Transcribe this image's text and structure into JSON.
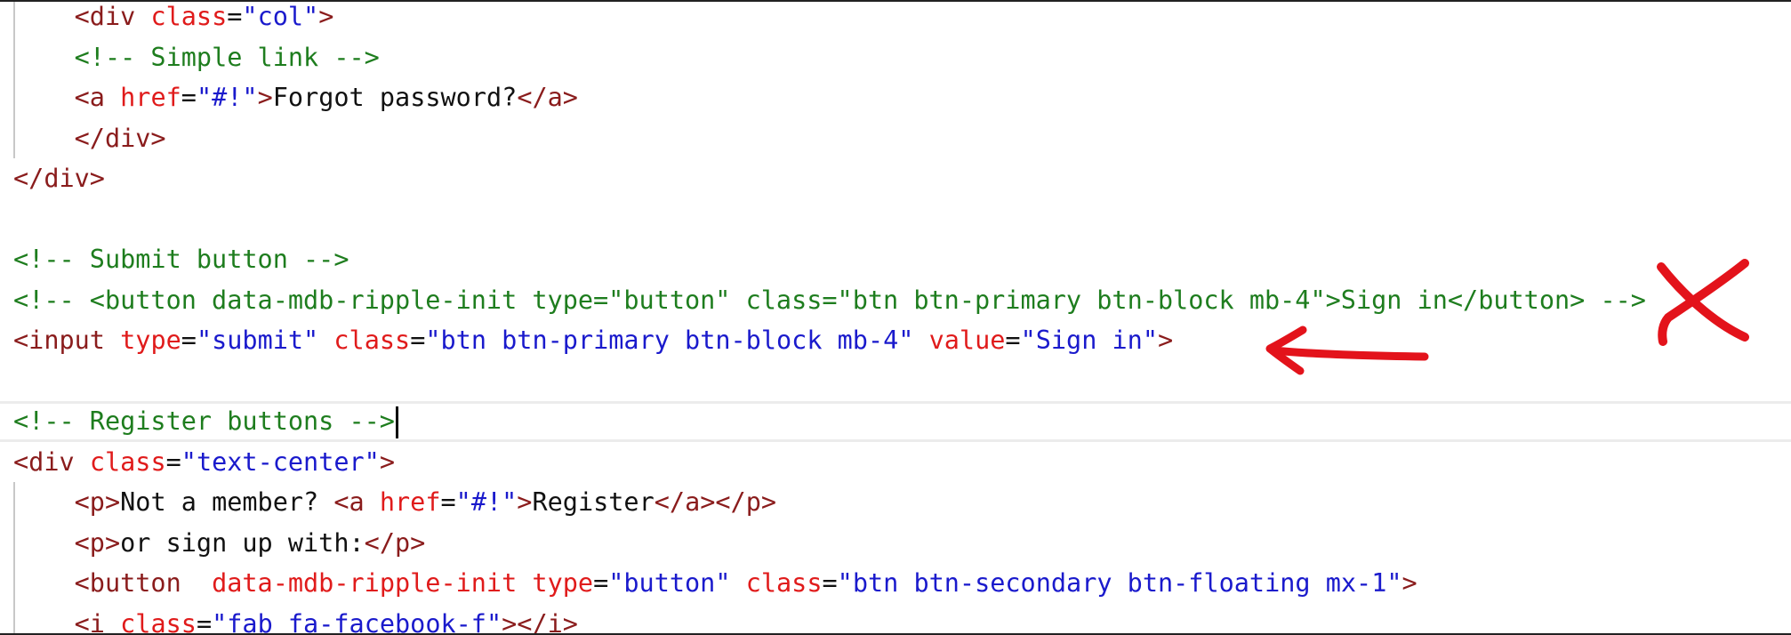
{
  "editor": {
    "lines": [
      {
        "indent": 1,
        "guide": true,
        "tokens": [
          {
            "t": "tag",
            "v": "<div"
          },
          {
            "t": "txt",
            "v": " "
          },
          {
            "t": "attr",
            "v": "class"
          },
          {
            "t": "eq",
            "v": "="
          },
          {
            "t": "str",
            "v": "\"col\""
          },
          {
            "t": "tag",
            "v": ">"
          }
        ]
      },
      {
        "indent": 1,
        "guide": true,
        "tokens": [
          {
            "t": "cmt",
            "v": "<!-- Simple link -->"
          }
        ]
      },
      {
        "indent": 1,
        "guide": true,
        "tokens": [
          {
            "t": "tag",
            "v": "<a"
          },
          {
            "t": "txt",
            "v": " "
          },
          {
            "t": "attr",
            "v": "href"
          },
          {
            "t": "eq",
            "v": "="
          },
          {
            "t": "str",
            "v": "\"#!\""
          },
          {
            "t": "tag",
            "v": ">"
          },
          {
            "t": "txt",
            "v": "Forgot password?"
          },
          {
            "t": "tag",
            "v": "</a>"
          }
        ]
      },
      {
        "indent": 1,
        "guide": true,
        "tokens": [
          {
            "t": "tag",
            "v": "</div>"
          }
        ]
      },
      {
        "indent": 0,
        "guide": false,
        "tokens": [
          {
            "t": "tag",
            "v": "</div>"
          }
        ]
      },
      {
        "indent": 0,
        "guide": false,
        "tokens": []
      },
      {
        "indent": 0,
        "guide": false,
        "tokens": [
          {
            "t": "cmt",
            "v": "<!-- Submit button -->"
          }
        ]
      },
      {
        "indent": 0,
        "guide": false,
        "tokens": [
          {
            "t": "cmt",
            "v": "<!-- <button data-mdb-ripple-init type=\"button\" class=\"btn btn-primary btn-block mb-4\">Sign in</button> -->"
          }
        ]
      },
      {
        "indent": 0,
        "guide": false,
        "tokens": [
          {
            "t": "tag",
            "v": "<input"
          },
          {
            "t": "txt",
            "v": " "
          },
          {
            "t": "attr",
            "v": "type"
          },
          {
            "t": "eq",
            "v": "="
          },
          {
            "t": "str",
            "v": "\"submit\""
          },
          {
            "t": "txt",
            "v": " "
          },
          {
            "t": "attr",
            "v": "class"
          },
          {
            "t": "eq",
            "v": "="
          },
          {
            "t": "str",
            "v": "\"btn btn-primary btn-block mb-4\""
          },
          {
            "t": "txt",
            "v": " "
          },
          {
            "t": "attr",
            "v": "value"
          },
          {
            "t": "eq",
            "v": "="
          },
          {
            "t": "str",
            "v": "\"Sign in\""
          },
          {
            "t": "tag",
            "v": ">"
          }
        ]
      },
      {
        "indent": 0,
        "guide": false,
        "tokens": []
      },
      {
        "indent": 0,
        "guide": false,
        "current": true,
        "caret": true,
        "tokens": [
          {
            "t": "cmt",
            "v": "<!-- Register buttons -->"
          }
        ]
      },
      {
        "indent": 0,
        "guide": false,
        "tokens": [
          {
            "t": "tag",
            "v": "<div"
          },
          {
            "t": "txt",
            "v": " "
          },
          {
            "t": "attr",
            "v": "class"
          },
          {
            "t": "eq",
            "v": "="
          },
          {
            "t": "str",
            "v": "\"text-center\""
          },
          {
            "t": "tag",
            "v": ">"
          }
        ]
      },
      {
        "indent": 1,
        "guide": true,
        "tokens": [
          {
            "t": "tag",
            "v": "<p>"
          },
          {
            "t": "txt",
            "v": "Not a member? "
          },
          {
            "t": "tag",
            "v": "<a"
          },
          {
            "t": "txt",
            "v": " "
          },
          {
            "t": "attr",
            "v": "href"
          },
          {
            "t": "eq",
            "v": "="
          },
          {
            "t": "str",
            "v": "\"#!\""
          },
          {
            "t": "tag",
            "v": ">"
          },
          {
            "t": "txt",
            "v": "Register"
          },
          {
            "t": "tag",
            "v": "</a></p>"
          }
        ]
      },
      {
        "indent": 1,
        "guide": true,
        "tokens": [
          {
            "t": "tag",
            "v": "<p>"
          },
          {
            "t": "txt",
            "v": "or sign up with:"
          },
          {
            "t": "tag",
            "v": "</p>"
          }
        ]
      },
      {
        "indent": 1,
        "guide": true,
        "tokens": [
          {
            "t": "tag",
            "v": "<button"
          },
          {
            "t": "txt",
            "v": "  "
          },
          {
            "t": "attr",
            "v": "data-mdb-ripple-init"
          },
          {
            "t": "txt",
            "v": " "
          },
          {
            "t": "attr",
            "v": "type"
          },
          {
            "t": "eq",
            "v": "="
          },
          {
            "t": "str",
            "v": "\"button\""
          },
          {
            "t": "txt",
            "v": " "
          },
          {
            "t": "attr",
            "v": "class"
          },
          {
            "t": "eq",
            "v": "="
          },
          {
            "t": "str",
            "v": "\"btn btn-secondary btn-floating mx-1\""
          },
          {
            "t": "tag",
            "v": ">"
          }
        ]
      },
      {
        "indent": 1,
        "guide": true,
        "tokens": [
          {
            "t": "tag",
            "v": "<i"
          },
          {
            "t": "txt",
            "v": " "
          },
          {
            "t": "attr",
            "v": "class"
          },
          {
            "t": "eq",
            "v": "="
          },
          {
            "t": "str",
            "v": "\"fab fa-facebook-f\""
          },
          {
            "t": "tag",
            "v": "></i>"
          }
        ]
      }
    ]
  },
  "annotations": {
    "arrow_icon": "red-arrow-icon",
    "cross_icon": "red-cross-icon",
    "color": "#e3131b"
  },
  "colors": {
    "tag": "#8a1c1c",
    "attribute": "#e01b1b",
    "string": "#1a1acc",
    "comment": "#1e7d1e",
    "text": "#111111"
  }
}
